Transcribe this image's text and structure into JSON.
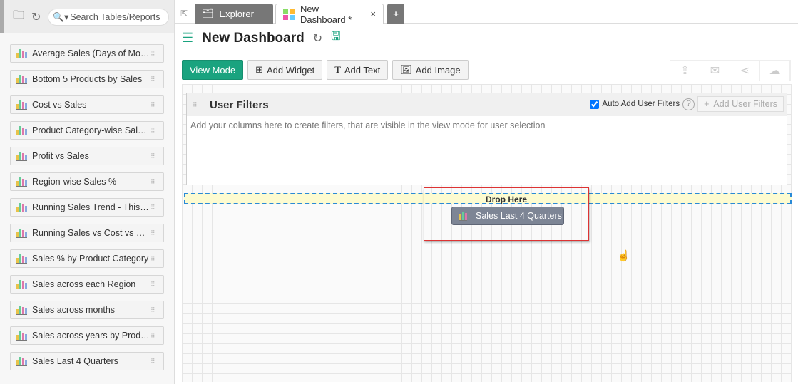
{
  "sidebar": {
    "search_placeholder": "Search Tables/Reports",
    "items": [
      "Average Sales (Days of Month)",
      "Bottom 5 Products by Sales",
      "Cost vs Sales",
      "Product Category-wise Sales %",
      "Profit vs Sales",
      "Region-wise Sales %",
      "Running Sales Trend - This Year",
      "Running Sales vs Cost vs Profit",
      "Sales % by Product Category",
      "Sales across each Region",
      "Sales across months",
      "Sales across years by Product",
      "Sales Last 4 Quarters"
    ]
  },
  "tabs": {
    "explorer": "Explorer",
    "dashboard": "New Dashboard *",
    "close": "×",
    "add": "+"
  },
  "header": {
    "title": "New Dashboard"
  },
  "toolbar": {
    "view_mode": "View Mode",
    "add_widget": "Add Widget",
    "add_text": "Add Text",
    "add_image": "Add Image"
  },
  "filters": {
    "title": "User Filters",
    "auto_add": "Auto Add User Filters",
    "help": "?",
    "add_button": "Add User Filters",
    "hint": "Add your columns here to create filters, that are visible in the view mode for user selection"
  },
  "drag": {
    "drop_label": "Drop Here",
    "chip_label": "Sales Last 4 Quarters"
  },
  "colors": {
    "accent": "#1aa37f",
    "drop_border": "#2a8ad6",
    "drop_bg": "#fdfbd0"
  }
}
